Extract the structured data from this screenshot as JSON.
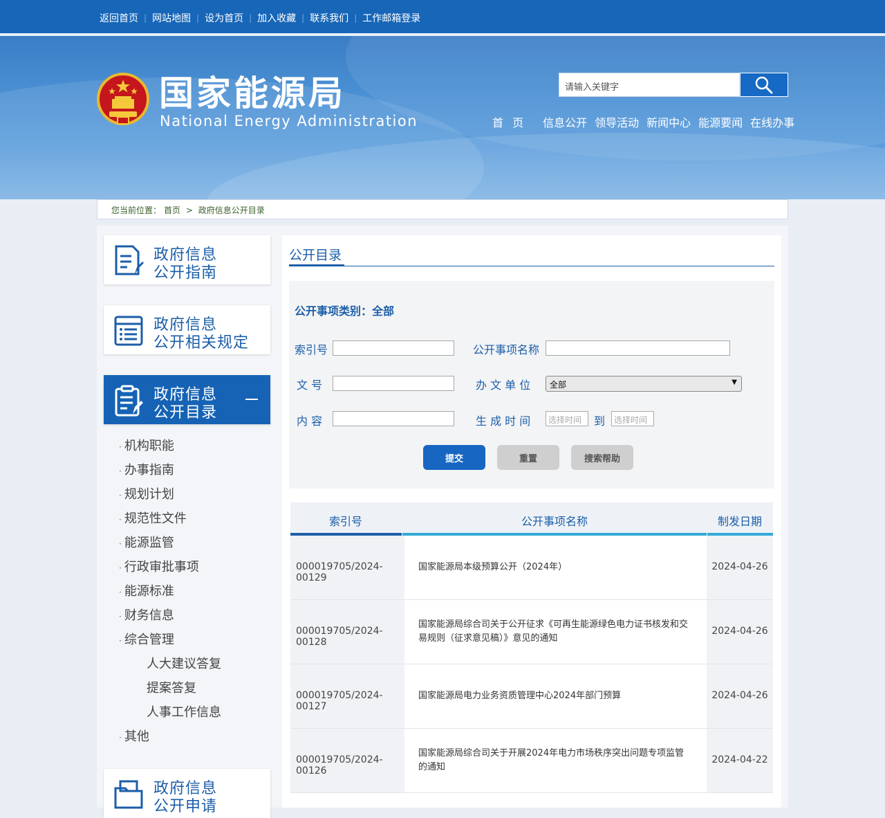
{
  "topbar": {
    "links": [
      "返回首页",
      "网站地图",
      "设为首页",
      "加入收藏",
      "联系我们",
      "工作邮箱登录"
    ]
  },
  "header": {
    "title_cn": "国家能源局",
    "title_en": "National Energy Administration",
    "search_placeholder": "请输入关键字",
    "nav": [
      "首 页",
      "信息公开",
      "领导活动",
      "新闻中心",
      "能源要闻",
      "在线办事"
    ],
    "search_icon": "search-icon"
  },
  "breadcrumb": {
    "prefix": "您当前位置：",
    "home": "首页",
    "separator": ">",
    "current": "政府信息公开目录"
  },
  "sidebar": {
    "cards": [
      {
        "line1": "政府信息",
        "line2": "公开指南",
        "icon": "document-edit-icon"
      },
      {
        "line1": "政府信息",
        "line2": "公开相关规定",
        "icon": "list-icon"
      },
      {
        "line1": "政府信息",
        "line2": "公开目录",
        "icon": "catalog-icon"
      },
      {
        "line1": "政府信息",
        "line2": "公开申请",
        "icon": "folder-icon"
      }
    ],
    "categories": [
      "机构职能",
      "办事指南",
      "规划计划",
      "规范性文件",
      "能源监管",
      "行政审批事项",
      "能源标准",
      "财务信息",
      "综合管理"
    ],
    "subcategories": [
      "人大建议答复",
      "提案答复",
      "人事工作信息"
    ],
    "last_category": "其他"
  },
  "main": {
    "title": "公开目录",
    "category_label": "公开事项类别：全部",
    "form": {
      "index_label": "索引号",
      "name_label": "公开事项名称",
      "docno_label": "文 号",
      "unit_label": "办 文 单 位",
      "unit_value": "全部",
      "content_label": "内 容",
      "date_label": "生 成 时 间",
      "date_from": "选择时间",
      "date_to_label": "到",
      "date_to": "选择时间",
      "submit": "提交",
      "reset": "重置",
      "help": "搜索帮助"
    },
    "table": {
      "headers": [
        "索引号",
        "公开事项名称",
        "制发日期"
      ],
      "rows": [
        {
          "index": "000019705/2024-00129",
          "name": "国家能源局本级预算公开（2024年）",
          "date": "2024-04-26"
        },
        {
          "index": "000019705/2024-00128",
          "name": "国家能源局综合司关于公开征求《可再生能源绿色电力证书核发和交易规则（征求意见稿）》意见的通知",
          "date": "2024-04-26"
        },
        {
          "index": "000019705/2024-00127",
          "name": "国家能源局电力业务资质管理中心2024年部门预算",
          "date": "2024-04-26"
        },
        {
          "index": "000019705/2024-00126",
          "name": "国家能源局综合司关于开展2024年电力市场秩序突出问题专项监管的通知",
          "date": "2024-04-22"
        }
      ]
    }
  },
  "colors": {
    "primary": "#1766b8",
    "accent_blue": "#1c5ea8",
    "table_bar_dark": "#1f5fa6",
    "table_bar_light": "#33a9d6"
  }
}
